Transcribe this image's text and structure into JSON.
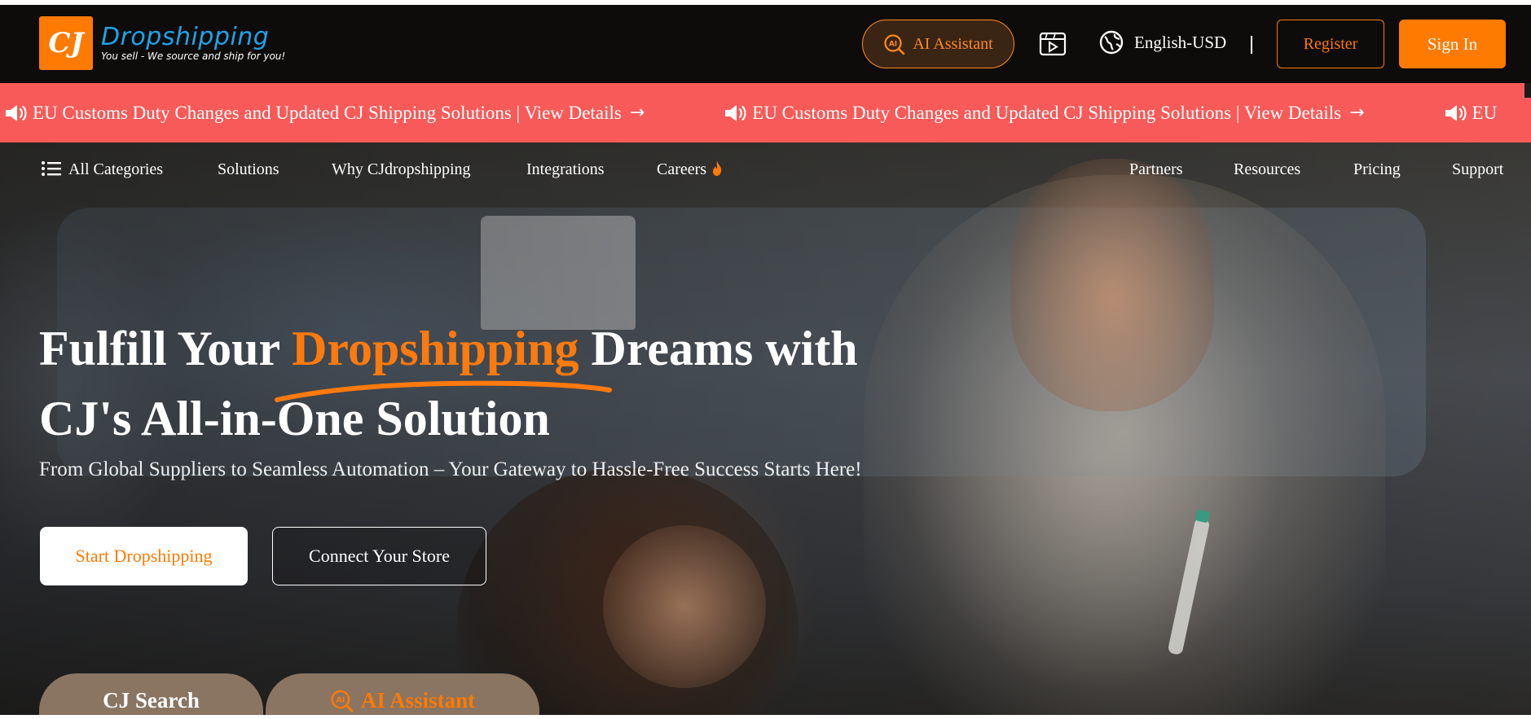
{
  "header": {
    "logo": {
      "mark": "CJ",
      "name": "Dropshipping",
      "tagline": "You sell - We source and ship for you!"
    },
    "ai_assistant_label": "AI Assistant",
    "video_icon": "video-play-icon",
    "language_label": "English-USD",
    "register_label": "Register",
    "signin_label": "Sign In"
  },
  "announcement": {
    "text": "EU Customs Duty Changes and Updated CJ Shipping Solutions | View Details",
    "arrow": "→",
    "truncated_text": "EU"
  },
  "catnav": {
    "all_categories": "All Categories",
    "solutions": "Solutions",
    "why": "Why CJdropshipping",
    "integrations": "Integrations",
    "careers": "Careers",
    "partners": "Partners",
    "resources": "Resources",
    "pricing": "Pricing",
    "support": "Support"
  },
  "hero": {
    "headline_pre": "Fulfill Your ",
    "headline_accent": "Dropshipping",
    "headline_post": " Dreams with",
    "headline_line2": "CJ's All-in-One Solution",
    "subheadline": "From Global Suppliers to Seamless Automation – Your Gateway to Hassle-Free Success Starts Here!",
    "start_button": "Start Dropshipping",
    "connect_button": "Connect Your Store",
    "tab_search": "CJ Search",
    "tab_ai": "AI Assistant"
  },
  "colors": {
    "brand_orange": "#ff7a00",
    "announce_bg": "#f75a58",
    "logo_blue": "#1fa3ea",
    "header_bg": "#0d0c0b",
    "tab_bg": "#8a7462"
  }
}
